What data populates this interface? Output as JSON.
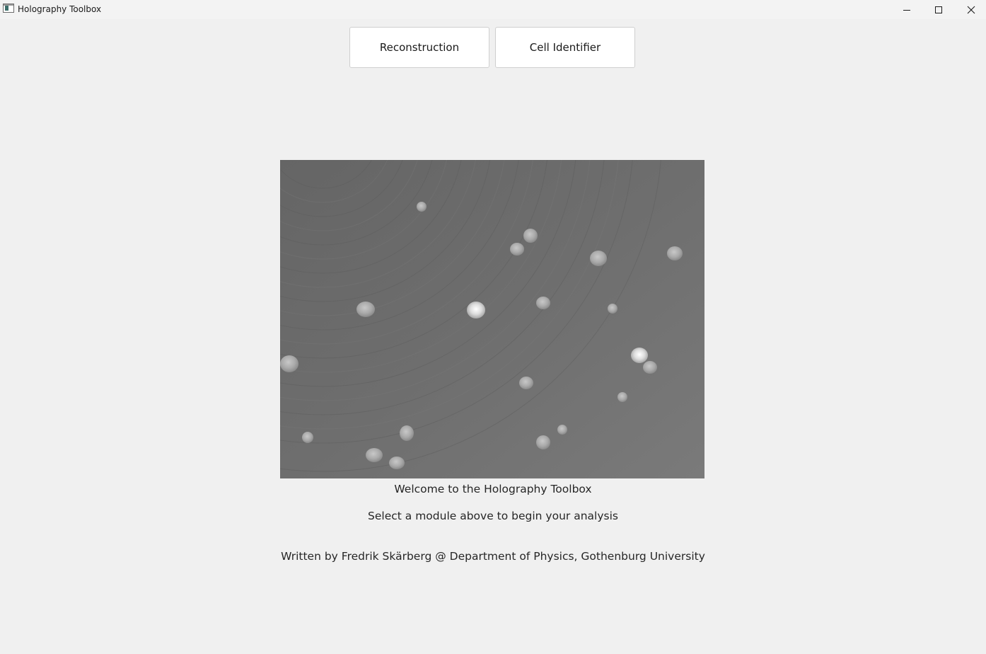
{
  "window": {
    "title": "Holography Toolbox",
    "controls": {
      "minimize_icon": "minimize-icon",
      "maximize_icon": "maximize-icon",
      "close_icon": "close-icon"
    }
  },
  "modules": {
    "reconstruction_label": "Reconstruction",
    "cell_identifier_label": "Cell Identifier"
  },
  "main": {
    "welcome": "Welcome to the Holography Toolbox",
    "instruction": "Select a module above to begin your analysis",
    "credit": "Written by Fredrik Skärberg @ Department of Physics, Gothenburg University"
  },
  "colors": {
    "background": "#f0f0f0",
    "button_bg": "#ffffff",
    "hologram_gray": "#6b6b6b"
  }
}
